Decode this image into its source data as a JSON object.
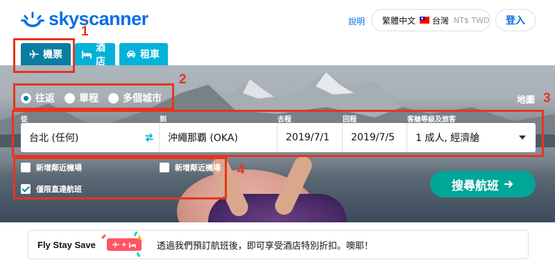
{
  "header": {
    "logo_text": "skyscanner",
    "help_label": "說明",
    "locale": {
      "language": "繁體中文",
      "country": "台灣",
      "currency": "NT$ TWD"
    },
    "login_label": "登入"
  },
  "tabs": [
    {
      "label": "機票",
      "icon": "airplane-icon",
      "active": true
    },
    {
      "label": "酒店",
      "icon": "bed-icon",
      "active": false
    },
    {
      "label": "租車",
      "icon": "car-icon",
      "active": false
    }
  ],
  "trip_types": [
    {
      "label": "往返",
      "checked": true
    },
    {
      "label": "單程",
      "checked": false
    },
    {
      "label": "多個城市",
      "checked": false
    }
  ],
  "map_label": "地圖",
  "fields": {
    "from": {
      "label": "從",
      "value": "台北 (任何)"
    },
    "to": {
      "label": "到",
      "value": "沖繩那覇 (OKA)"
    },
    "depart": {
      "label": "去程",
      "value": "2019/7/1"
    },
    "return": {
      "label": "回程",
      "value": "2019/7/5"
    },
    "cabin": {
      "label": "客艙等級及旅客",
      "value": "1 成人, 經濟艙"
    }
  },
  "options": {
    "nearby_from": {
      "label": "新增鄰近機場",
      "checked": false
    },
    "nearby_to": {
      "label": "新增鄰近機場",
      "checked": false
    },
    "direct_only": {
      "label": "僅限直達航班",
      "checked": true
    }
  },
  "search_button_label": "搜尋航班",
  "promo": {
    "title": "Fly Stay Save",
    "text": "透過我們預訂航班後，即可享受酒店特別折扣。噢耶！"
  },
  "annotations": [
    "1",
    "2",
    "3",
    "4"
  ],
  "colors": {
    "brand": "#0770e3",
    "tab": "#02b2d8",
    "tab_active": "#0b7da0",
    "search_button": "#00a698",
    "annotation": "#e8341c",
    "promo_badge": "#ff5462"
  }
}
